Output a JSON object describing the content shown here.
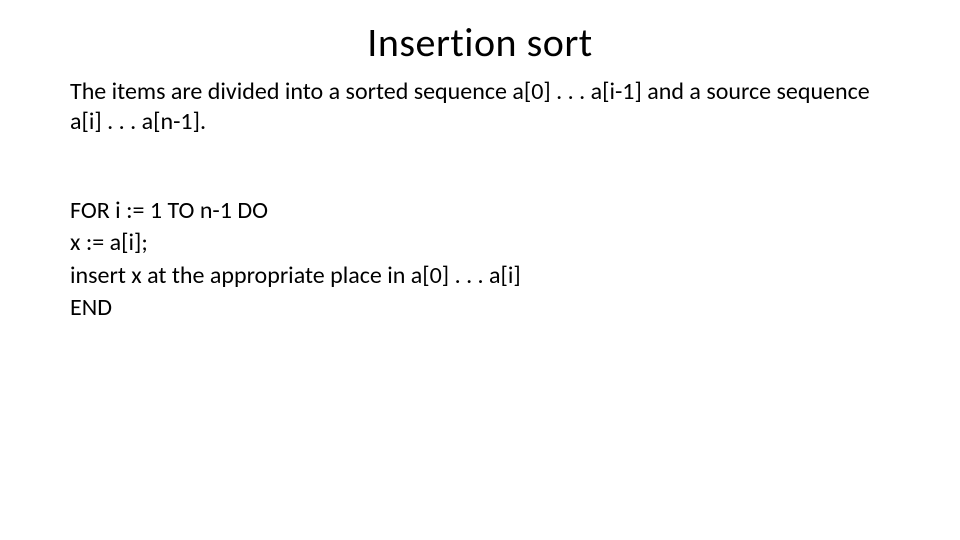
{
  "title": "Insertion sort",
  "description": "The items are divided into a sorted sequence a[0] . . . a[i-1] and a source sequence a[i] . . . a[n-1].",
  "code": {
    "line1": "FOR i := 1 TO n-1 DO",
    "line2": "x := a[i];",
    "line3": "insert x at the appropriate place in a[0] . . . a[i]",
    "line4": "END"
  }
}
